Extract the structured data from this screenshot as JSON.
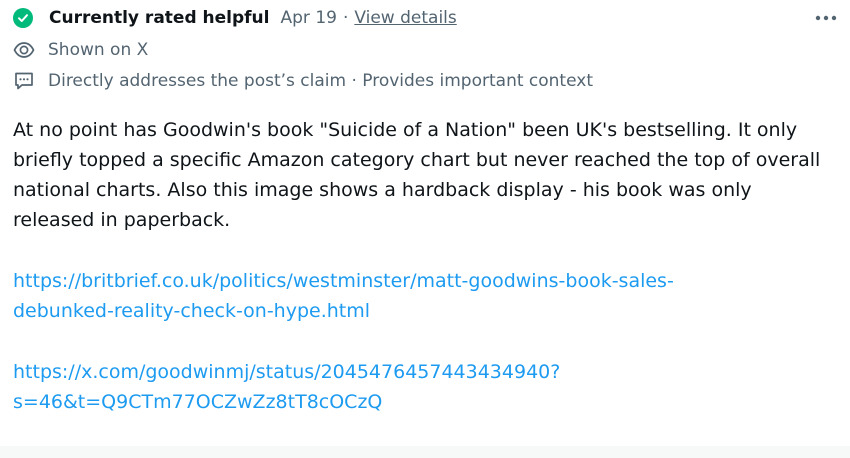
{
  "status": {
    "label": "Currently rated helpful",
    "date": "Apr 19",
    "separator": "·",
    "details_link": "View details",
    "badge_color": "#00ba7c",
    "badge_icon": "check-icon"
  },
  "menu": {
    "icon": "more-horizontal-icon"
  },
  "shown_on": {
    "icon": "eye-icon",
    "text": "Shown on X"
  },
  "reasons": {
    "icon": "comment-icon",
    "text": "Directly addresses the post’s claim · Provides important context"
  },
  "note": {
    "body": "At no point has Goodwin's book \"Suicide of a Nation\" been UK's bestselling. It only briefly topped a specific Amazon category chart but never reached the top of overall national charts. Also this image shows a hardback display - his book was only released in paperback.",
    "links": [
      {
        "lines": [
          "https://britbrief.co.uk/politics/westminster/matt-goodwins-book-sales-",
          "debunked-reality-check-on-hype.html"
        ]
      },
      {
        "lines": [
          "https://x.com/goodwinmj/status/2045476457443434940?",
          "s=46&t=Q9CTm77OCZwZz8tT8cOCzQ"
        ]
      }
    ]
  },
  "colors": {
    "text_primary": "#0f1419",
    "text_secondary": "#536471",
    "link": "#1d9bf0"
  }
}
